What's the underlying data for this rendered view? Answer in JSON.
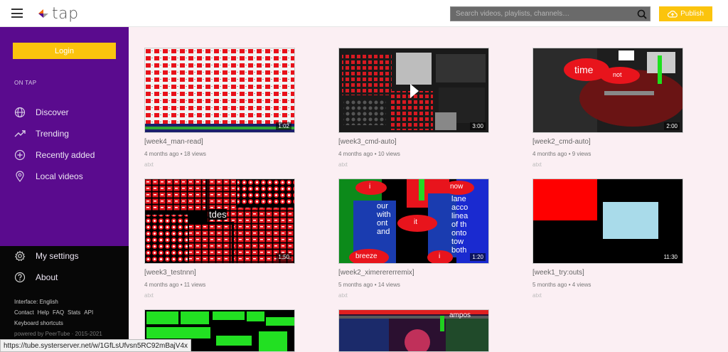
{
  "header": {
    "logo_text": "tap",
    "search_placeholder": "Search videos, playlists, channels…",
    "publish_label": "Publish"
  },
  "sidebar": {
    "login_label": "Login",
    "section_title": "ON TAP",
    "items": [
      {
        "label": "Discover",
        "icon": "globe-icon"
      },
      {
        "label": "Trending",
        "icon": "trending-icon"
      },
      {
        "label": "Recently added",
        "icon": "plus-circle-icon"
      },
      {
        "label": "Local videos",
        "icon": "location-pin-icon"
      }
    ],
    "bottom_items": [
      {
        "label": "My settings",
        "icon": "gear-icon"
      },
      {
        "label": "About",
        "icon": "help-circle-icon"
      }
    ],
    "interface_language": "Interface: English",
    "footer_links": [
      "Contact",
      "Help",
      "FAQ",
      "Stats",
      "API"
    ],
    "keyboard_shortcuts": "Keyboard shortcuts",
    "powered_by": "powered by PeerTube · 2015-2021"
  },
  "videos": [
    {
      "title": "[week4_man-read]",
      "meta": "4 months ago • 18 views",
      "channel": "atxt",
      "duration": "1:02"
    },
    {
      "title": "[week3_cmd-auto]",
      "meta": "4 months ago • 10 views",
      "channel": "atxt",
      "duration": "3:00"
    },
    {
      "title": "[week2_cmd-auto]",
      "meta": "4 months ago • 9 views",
      "channel": "atxt",
      "duration": "2:00"
    },
    {
      "title": "[week3_testnnn]",
      "meta": "4 months ago • 11 views",
      "channel": "atxt",
      "duration": "1:50"
    },
    {
      "title": "[week2_ximerererremix]",
      "meta": "5 months ago • 14 views",
      "channel": "atxt",
      "duration": "1:20"
    },
    {
      "title": "[week1_try:outs]",
      "meta": "5 months ago • 4 views",
      "channel": "atxt",
      "duration": "11:30"
    },
    {
      "title": "",
      "meta": "",
      "channel": "",
      "duration": ""
    },
    {
      "title": "",
      "meta": "",
      "channel": "",
      "duration": ""
    }
  ],
  "thumbnail_text": {
    "v3_time": "time",
    "v3_not": "not",
    "v4_tdes": "tdes",
    "v5_i": "i",
    "v5_now": "now",
    "v5_it": "it",
    "v5_breeze": "breeze",
    "v5_i2": "i",
    "v5_words": "lane acco linea of th onto tow both",
    "v5_our": "our with ont and",
    "v8_text": "ampos"
  },
  "status_bar_url": "https://tube.systerserver.net/w/1GfLsUfvsn5RC92mBajV4x",
  "colors": {
    "sidebar": "#5a0b8e",
    "accent": "#fbc40d",
    "page_bg": "#fbeff3"
  }
}
